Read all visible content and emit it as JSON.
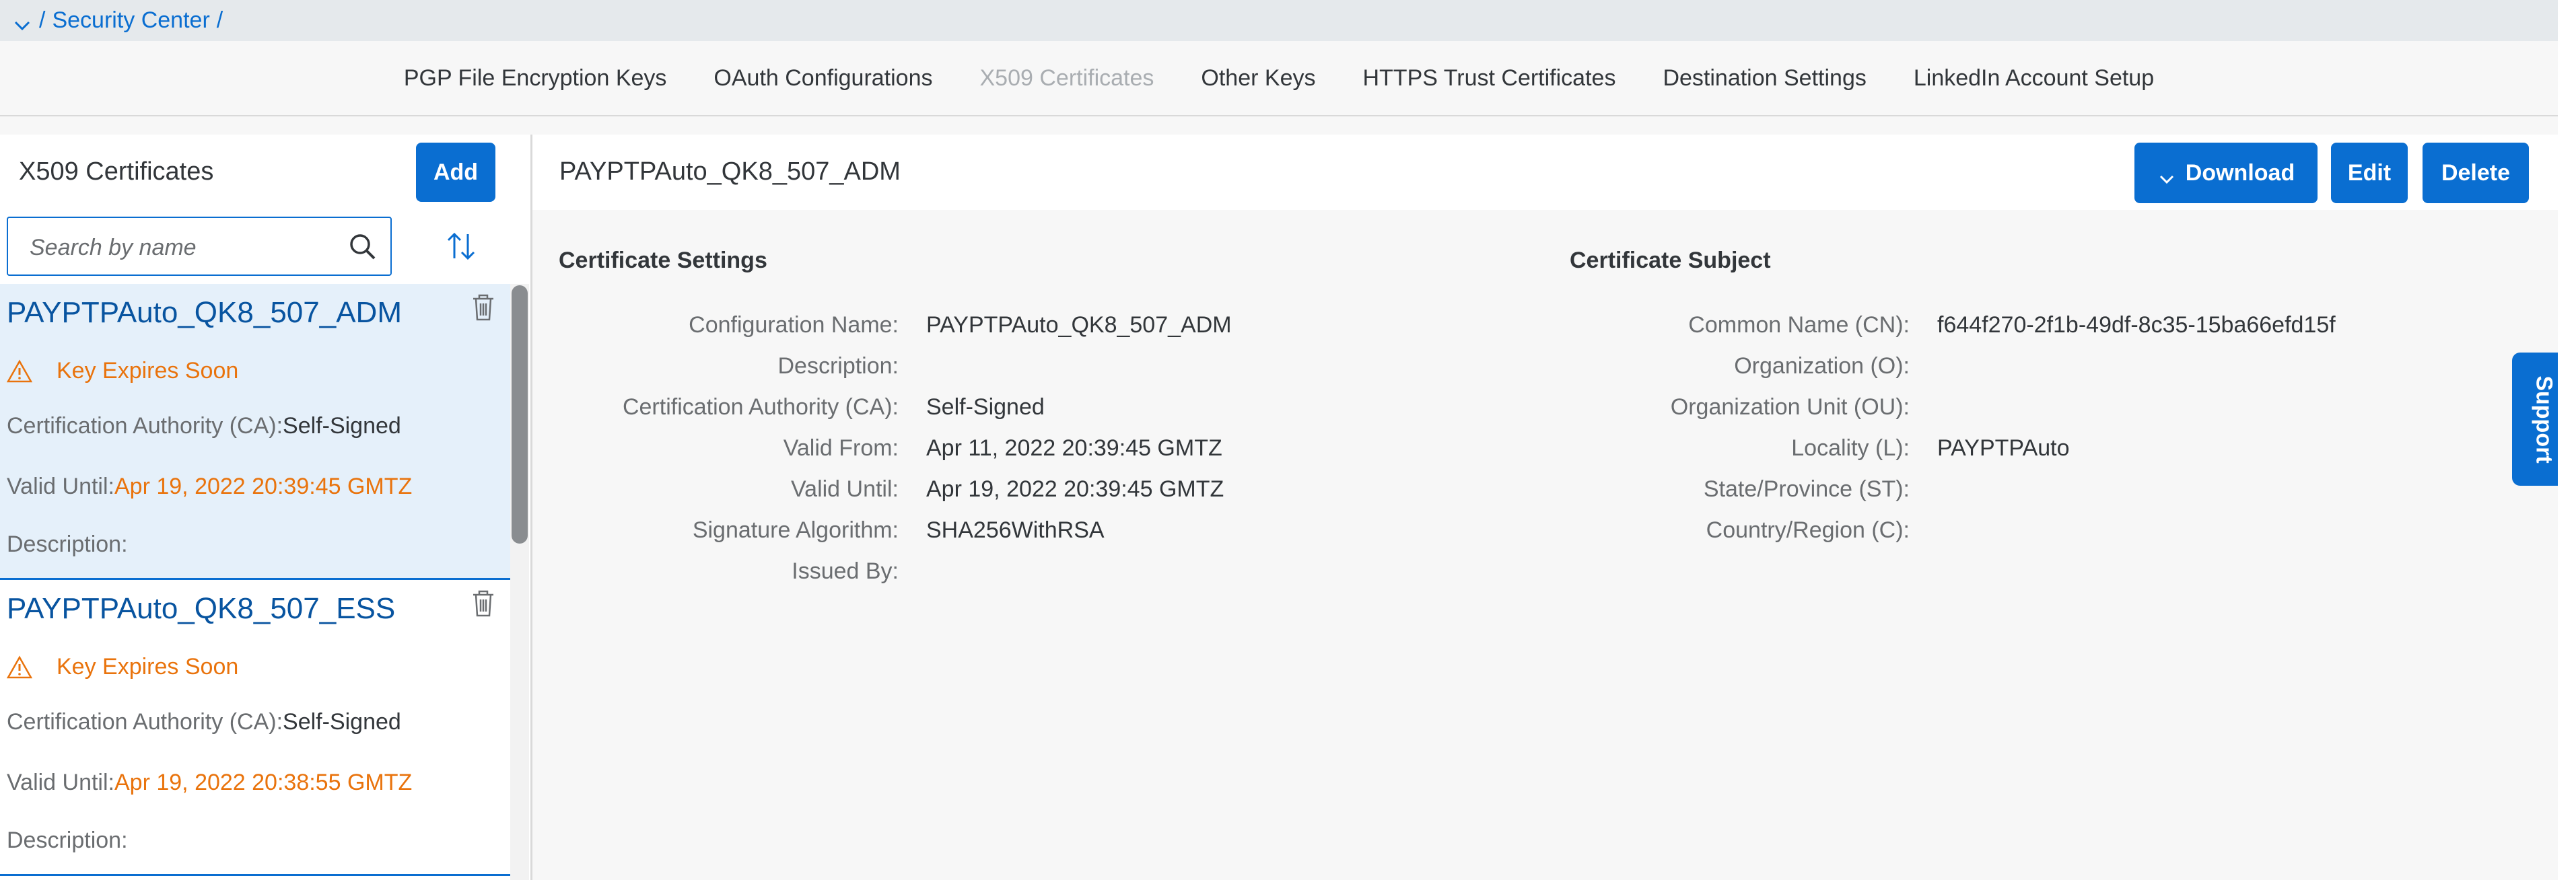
{
  "breadcrumb": {
    "separator1": "/",
    "section": "Security Center",
    "separator2": "/"
  },
  "tabs": [
    {
      "label": "PGP File Encryption Keys",
      "disabled": false
    },
    {
      "label": "OAuth Configurations",
      "disabled": false
    },
    {
      "label": "X509 Certificates",
      "disabled": true
    },
    {
      "label": "Other Keys",
      "disabled": false
    },
    {
      "label": "HTTPS Trust Certificates",
      "disabled": false
    },
    {
      "label": "Destination Settings",
      "disabled": false
    },
    {
      "label": "LinkedIn Account Setup",
      "disabled": false
    }
  ],
  "list_panel": {
    "title": "X509 Certificates",
    "add_label": "Add",
    "search_placeholder": "Search by name",
    "items": [
      {
        "name": "PAYPTPAuto_QK8_507_ADM",
        "warning": "Key Expires Soon",
        "ca_label": "Certification Authority (CA):",
        "ca_value": "Self-Signed",
        "valid_until_label": "Valid Until:",
        "valid_until_value": "Apr 19, 2022 20:39:45 GMTZ",
        "description_label": "Description:"
      },
      {
        "name": "PAYPTPAuto_QK8_507_ESS",
        "warning": "Key Expires Soon",
        "ca_label": "Certification Authority (CA):",
        "ca_value": "Self-Signed",
        "valid_until_label": "Valid Until:",
        "valid_until_value": "Apr 19, 2022 20:38:55 GMTZ",
        "description_label": "Description:"
      }
    ]
  },
  "detail": {
    "title": "PAYPTPAuto_QK8_507_ADM",
    "download_label": "Download",
    "edit_label": "Edit",
    "delete_label": "Delete",
    "settings": {
      "title": "Certificate Settings",
      "fields": [
        {
          "label": "Configuration Name:",
          "value": "PAYPTPAuto_QK8_507_ADM"
        },
        {
          "label": "Description:",
          "value": ""
        },
        {
          "label": "Certification Authority (CA):",
          "value": "Self-Signed"
        },
        {
          "label": "Valid From:",
          "value": "Apr 11, 2022 20:39:45 GMTZ"
        },
        {
          "label": "Valid Until:",
          "value": "Apr 19, 2022 20:39:45 GMTZ"
        },
        {
          "label": "Signature Algorithm:",
          "value": "SHA256WithRSA"
        },
        {
          "label": "Issued By:",
          "value": ""
        }
      ]
    },
    "subject": {
      "title": "Certificate Subject",
      "fields": [
        {
          "label": "Common Name (CN):",
          "value": "f644f270-2f1b-49df-8c35-15ba66efd15f"
        },
        {
          "label": "Organization (O):",
          "value": ""
        },
        {
          "label": "Organization Unit (OU):",
          "value": ""
        },
        {
          "label": "Locality (L):",
          "value": "PAYPTPAuto"
        },
        {
          "label": "State/Province (ST):",
          "value": ""
        },
        {
          "label": "Country/Region (C):",
          "value": ""
        }
      ]
    }
  },
  "support_label": "Support",
  "colors": {
    "accent": "#0a6ed1",
    "warning": "#e9730c",
    "link": "#0854a0",
    "selected_bg": "#e5f0fa"
  }
}
